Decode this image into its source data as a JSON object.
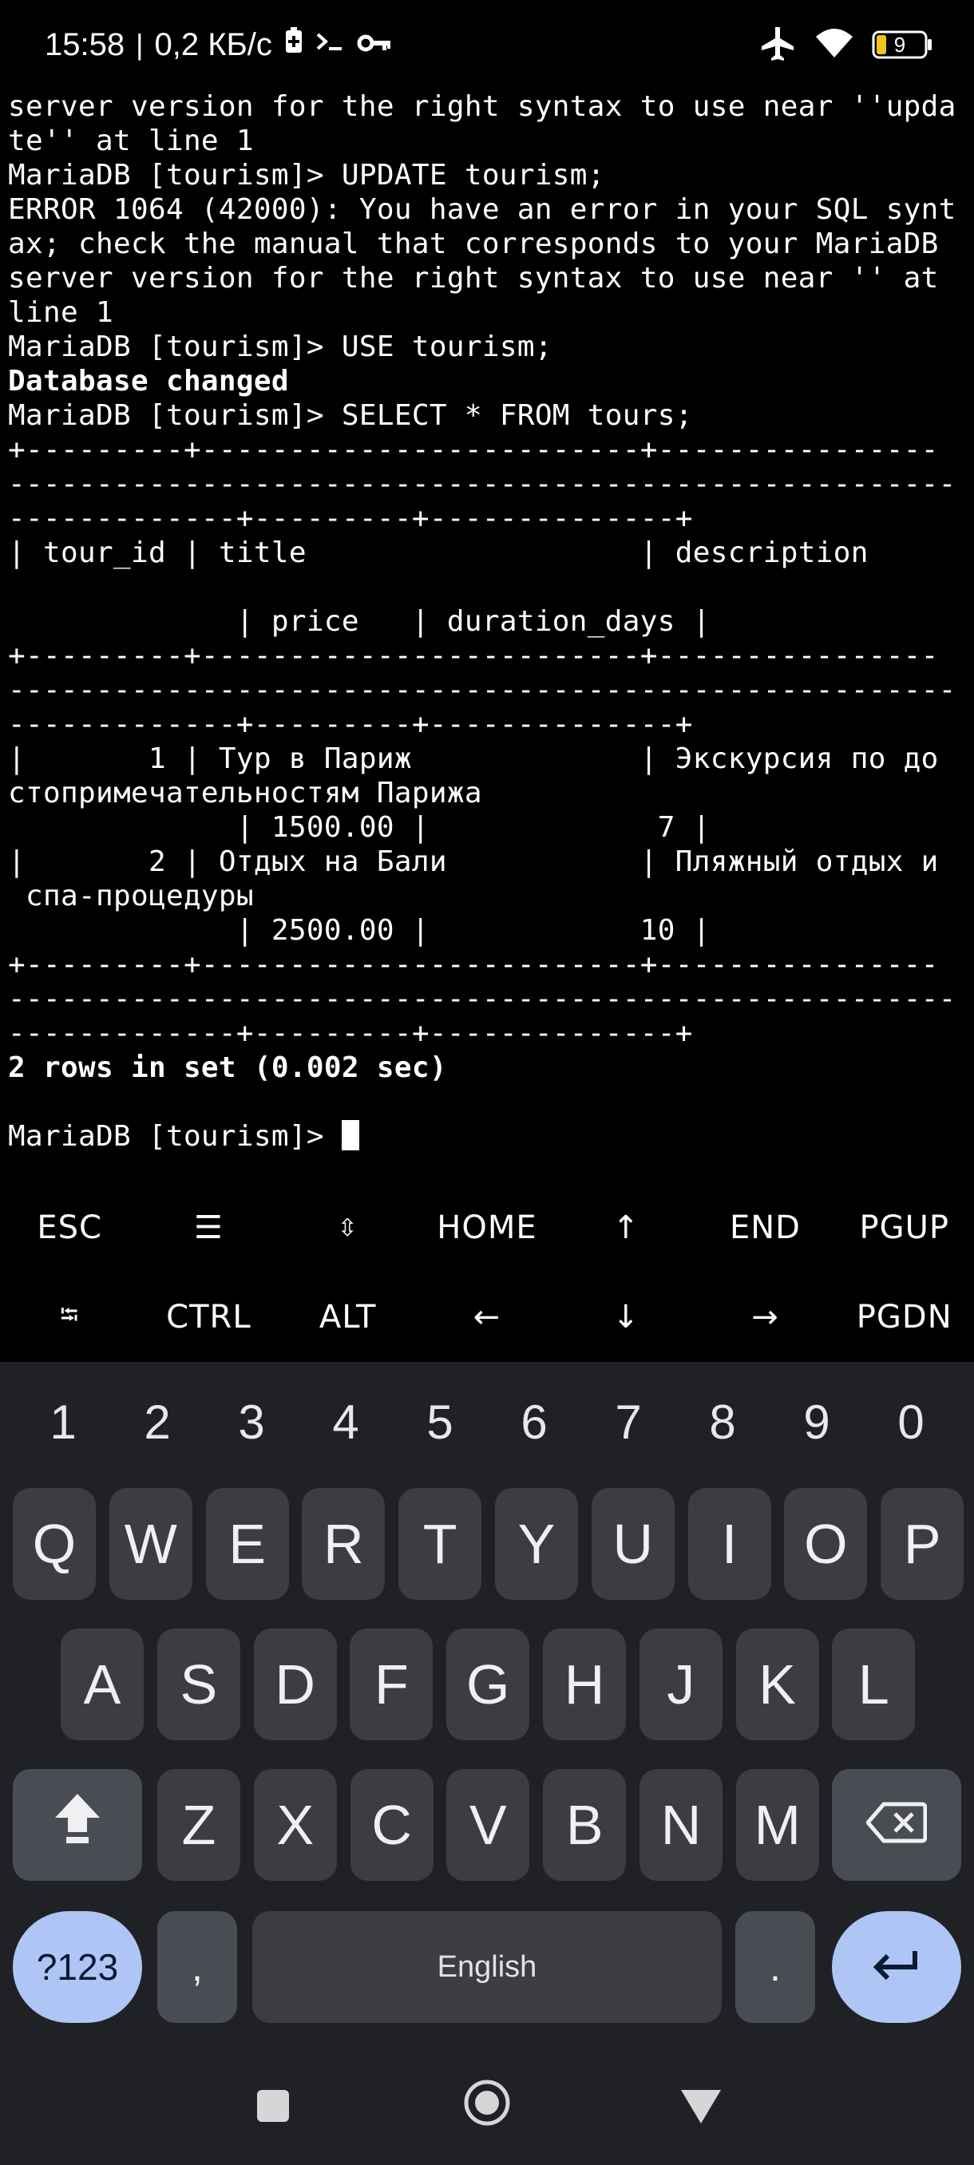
{
  "status_bar": {
    "time": "15:58",
    "network_speed": "0,2 КБ/с",
    "battery": "9"
  },
  "terminal": {
    "lines": [
      {
        "text": "server version for the right syntax to use near ''upda",
        "bold": false
      },
      {
        "text": "te'' at line 1",
        "bold": false
      },
      {
        "text": "MariaDB [tourism]> UPDATE tourism;",
        "bold": false
      },
      {
        "text": "ERROR 1064 (42000): You have an error in your SQL synt",
        "bold": false
      },
      {
        "text": "ax; check the manual that corresponds to your MariaDB",
        "bold": false
      },
      {
        "text": "server version for the right syntax to use near '' at",
        "bold": false
      },
      {
        "text": "line 1",
        "bold": false
      },
      {
        "text": "MariaDB [tourism]> USE tourism;",
        "bold": false
      },
      {
        "text": "Database changed",
        "bold": true
      },
      {
        "text": "MariaDB [tourism]> SELECT * FROM tours;",
        "bold": false
      },
      {
        "text": "+---------+-------------------------+----------------",
        "bold": false
      },
      {
        "text": "------------------------------------------------------",
        "bold": false
      },
      {
        "text": "-------------+---------+--------------+",
        "bold": false
      },
      {
        "text": "| tour_id | title                   | description",
        "bold": false
      },
      {
        "text": "",
        "bold": false
      },
      {
        "text": "             | price   | duration_days |",
        "bold": false
      },
      {
        "text": "+---------+-------------------------+----------------",
        "bold": false
      },
      {
        "text": "------------------------------------------------------",
        "bold": false
      },
      {
        "text": "-------------+---------+--------------+",
        "bold": false
      },
      {
        "text": "|       1 | Тур в Париж             | Экскурсия по до",
        "bold": false
      },
      {
        "text": "стопримечательностям Парижа",
        "bold": false
      },
      {
        "text": "             | 1500.00 |             7 |",
        "bold": false
      },
      {
        "text": "|       2 | Отдых на Бали           | Пляжный отдых и",
        "bold": false
      },
      {
        "text": " спа-процедуры",
        "bold": false
      },
      {
        "text": "             | 2500.00 |            10 |",
        "bold": false
      },
      {
        "text": "+---------+-------------------------+----------------",
        "bold": false
      },
      {
        "text": "------------------------------------------------------",
        "bold": false
      },
      {
        "text": "-------------+---------+--------------+",
        "bold": false
      },
      {
        "text": "2 rows in set (0.002 sec)",
        "bold": true
      },
      {
        "text": "",
        "bold": false
      }
    ],
    "prompt": "MariaDB [tourism]> "
  },
  "extra_keys": {
    "row1": [
      {
        "label": "ESC",
        "icon": ""
      },
      {
        "label": "☰",
        "icon": "drawer-icon"
      },
      {
        "label": "⇳",
        "icon": "updown-icon"
      },
      {
        "label": "HOME",
        "icon": ""
      },
      {
        "label": "↑",
        "icon": "arrow-up-icon"
      },
      {
        "label": "END",
        "icon": ""
      },
      {
        "label": "PGUP",
        "icon": ""
      }
    ],
    "row2": [
      {
        "label": "⭾",
        "icon": "tab-icon"
      },
      {
        "label": "CTRL",
        "icon": ""
      },
      {
        "label": "ALT",
        "icon": ""
      },
      {
        "label": "←",
        "icon": "arrow-left-icon"
      },
      {
        "label": "↓",
        "icon": "arrow-down-icon"
      },
      {
        "label": "→",
        "icon": "arrow-right-icon"
      },
      {
        "label": "PGDN",
        "icon": ""
      }
    ]
  },
  "keyboard": {
    "numbers": [
      "1",
      "2",
      "3",
      "4",
      "5",
      "6",
      "7",
      "8",
      "9",
      "0"
    ],
    "row1": [
      "Q",
      "W",
      "E",
      "R",
      "T",
      "Y",
      "U",
      "I",
      "O",
      "P"
    ],
    "row2": [
      "A",
      "S",
      "D",
      "F",
      "G",
      "H",
      "J",
      "K",
      "L"
    ],
    "row3": [
      "Z",
      "X",
      "C",
      "V",
      "B",
      "N",
      "M"
    ],
    "symbols_label": "?123",
    "comma": ",",
    "space_label": "English",
    "period": ".",
    "colors": {
      "background": "#1f2125",
      "key": "#3b3d43",
      "accent": "#aec5f5"
    }
  }
}
